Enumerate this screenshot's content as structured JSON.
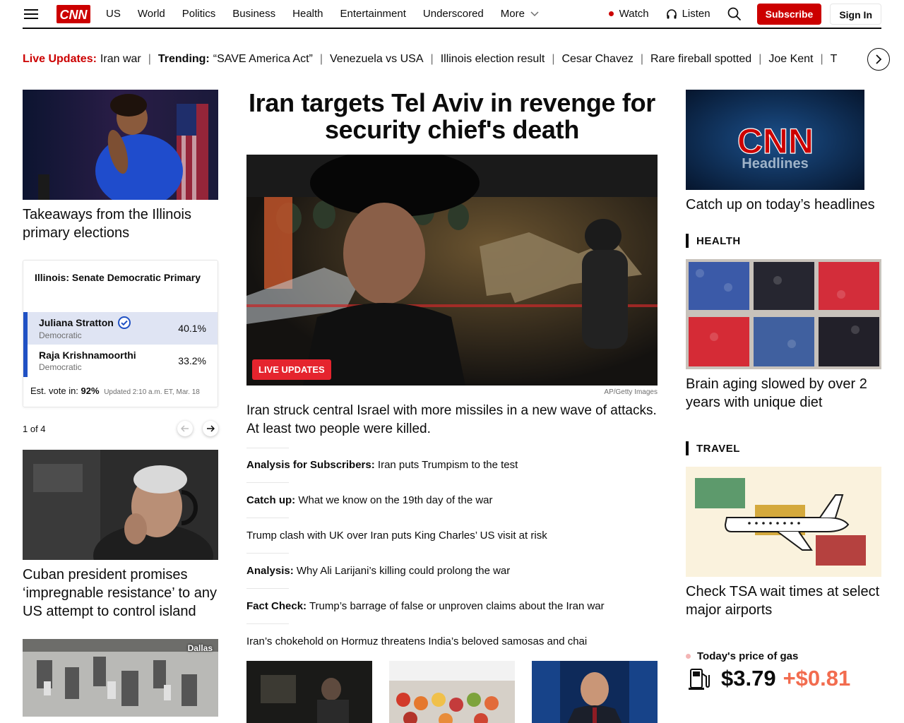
{
  "nav": {
    "items": [
      "US",
      "World",
      "Politics",
      "Business",
      "Health",
      "Entertainment",
      "Underscored",
      "More"
    ],
    "watch": "Watch",
    "listen": "Listen",
    "subscribe": "Subscribe",
    "sign_in": "Sign In"
  },
  "ticker": {
    "live_label": "Live Updates:",
    "live_item": "Iran war",
    "trending_label": "Trending:",
    "items": [
      "“SAVE America Act”",
      "Venezuela vs USA",
      "Illinois election result",
      "Cesar Chavez",
      "Rare fireball spotted",
      "Joe Kent",
      "T"
    ]
  },
  "left": {
    "story1": "Takeaways from the Illinois primary elections",
    "race": {
      "title": "Illinois: Senate Democratic Primary",
      "candidates": [
        {
          "name": "Juliana Stratton",
          "party": "Democratic",
          "pct": "40.1%",
          "winner": true
        },
        {
          "name": "Raja Krishnamoorthi",
          "party": "Democratic",
          "pct": "33.2%",
          "winner": false
        }
      ],
      "est_label": "Est. vote in:",
      "est_value": "92%",
      "updated": "Updated 2:10 a.m. ET, Mar. 18"
    },
    "pager": "1 of 4",
    "story2": "Cuban president promises ‘impregnable resistance’ to any US attempt to control island",
    "story3_tag": "Dallas"
  },
  "center": {
    "title": "Iran targets Tel Aviv in revenge for security chief's death",
    "badge": "LIVE UPDATES",
    "credit": "AP/Getty Images",
    "lede": "Iran struck central Israel with more missiles in a new wave of attacks. At least two people were killed.",
    "stories": [
      {
        "label": "Analysis for Subscribers:",
        "text": "Iran puts Trumpism to the test"
      },
      {
        "label": "Catch up:",
        "text": "What we know on the 19th day of the war"
      },
      {
        "label": "",
        "text": "Trump clash with UK over Iran puts King Charles’ US visit at risk"
      },
      {
        "label": "Analysis:",
        "text": "Why Ali Larijani’s killing could prolong the war"
      },
      {
        "label": "Fact Check:",
        "text": "Trump’s barrage of false or unproven claims about the Iran war"
      },
      {
        "label": "",
        "text": "Iran’s chokehold on Hormuz threatens India’s beloved samosas and chai"
      }
    ]
  },
  "right": {
    "promo_brand": "Headlines",
    "promo_text": "Catch up on today’s headlines",
    "health_label": "HEALTH",
    "health_story": "Brain aging slowed by over 2 years with unique diet",
    "travel_label": "TRAVEL",
    "travel_story": "Check TSA wait times at select major airports",
    "gas": {
      "title": "Today's price of gas",
      "price": "$3.79",
      "change": "+$0.81"
    }
  }
}
